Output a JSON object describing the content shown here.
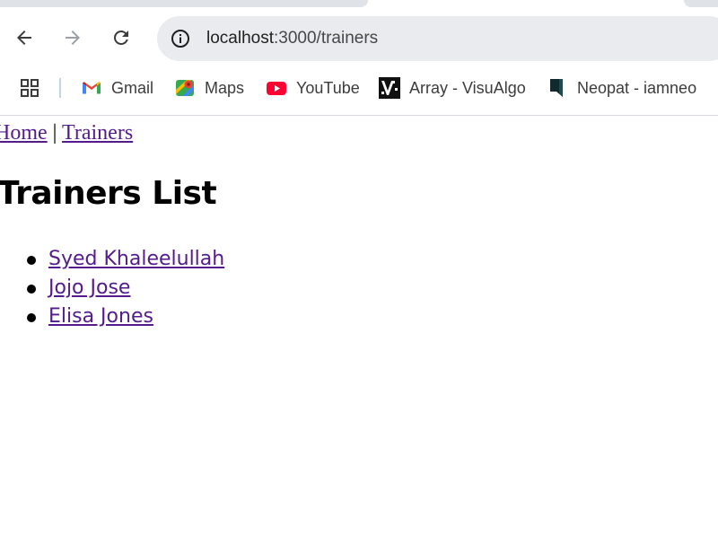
{
  "browser": {
    "url_host": "localhost",
    "url_path": ":3000/trainers",
    "bookmarks": [
      {
        "label": "Gmail",
        "icon": "gmail-icon"
      },
      {
        "label": "Maps",
        "icon": "maps-icon"
      },
      {
        "label": "YouTube",
        "icon": "youtube-icon"
      },
      {
        "label": "Array - VisuAlgo",
        "icon": "visualgo-icon"
      },
      {
        "label": "Neopat - iamneo",
        "icon": "neopat-icon"
      }
    ]
  },
  "page": {
    "nav": {
      "home": "Home",
      "separator": "|",
      "trainers": "Trainers"
    },
    "title": "Trainers List",
    "trainers": [
      "Syed Khaleelullah",
      "Jojo Jose",
      "Elisa Jones"
    ]
  },
  "colors": {
    "link_visited": "#551a8b",
    "omnibox_bg": "#e9ebee",
    "youtube_red": "#ff0033"
  }
}
